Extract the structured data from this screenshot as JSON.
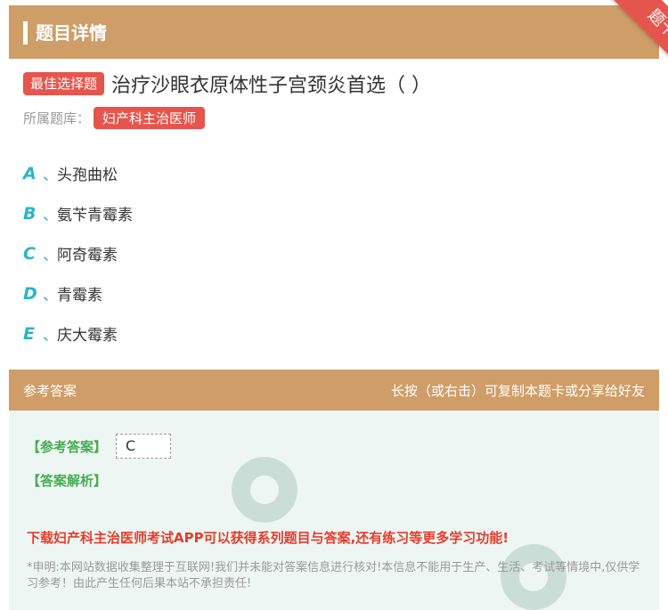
{
  "header": {
    "title": "题目详情",
    "ribbon": "题卡"
  },
  "question": {
    "type_badge": "最佳选择题",
    "text": "治疗沙眼衣原体性子宫颈炎首选（ ）",
    "bank_label": "所属题库：",
    "bank_name": "妇产科主治医师"
  },
  "options": [
    {
      "letter": "A",
      "sep": "、",
      "text": "头孢曲松"
    },
    {
      "letter": "B",
      "sep": "、",
      "text": "氨苄青霉素"
    },
    {
      "letter": "C",
      "sep": "、",
      "text": "阿奇霉素"
    },
    {
      "letter": "D",
      "sep": "、",
      "text": "青霉素"
    },
    {
      "letter": "E",
      "sep": "、",
      "text": "庆大霉素"
    }
  ],
  "answer_section": {
    "title": "参考答案",
    "hint": "长按（或右击）可复制本题卡或分享给好友",
    "answer_label": "【参考答案】",
    "answer_value": "C",
    "analysis_label": "【答案解析】",
    "promo": "下载妇产科主治医师考试APP可以获得系列题目与答案,还有练习等更多学习功能!",
    "disclaimer": "*申明:本网站数据收集整理于互联网!我们并未能对答案信息进行核对!本信息不能用于生产、生活、考试等情境中,仅供学习参考！由此产生任何后果本站不承担责任!"
  },
  "colors": {
    "accent": "#cf9d68",
    "red": "#e6554d",
    "teal": "#2bb5c6",
    "green": "#45ad52"
  }
}
